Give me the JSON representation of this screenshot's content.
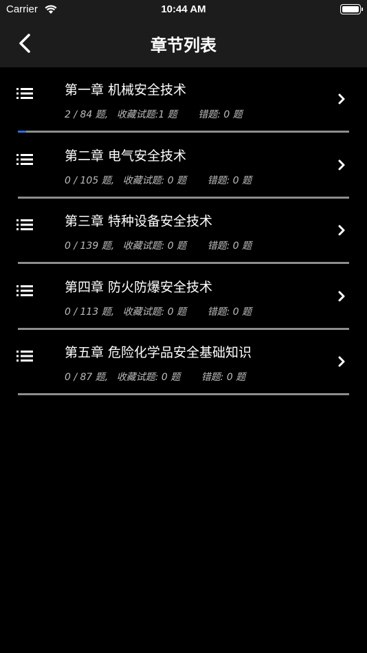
{
  "status_bar": {
    "carrier": "Carrier",
    "time": "10:44 AM"
  },
  "nav": {
    "title": "章节列表",
    "back_icon": "chevron-left-icon"
  },
  "chapters": [
    {
      "title": "第一章 机械安全技术",
      "progress": "2 / 84 题,",
      "favorites": "收藏试题:1 题",
      "errors": "错题: 0 题",
      "progress_fraction": 0.024
    },
    {
      "title": "第二章 电气安全技术",
      "progress": "0 / 105 题,",
      "favorites": "收藏试题: 0 题",
      "errors": "错题: 0 题",
      "progress_fraction": 0
    },
    {
      "title": "第三章 特种设备安全技术",
      "progress": "0 / 139 题,",
      "favorites": "收藏试题: 0 题",
      "errors": "错题: 0 题",
      "progress_fraction": 0
    },
    {
      "title": "第四章 防火防爆安全技术",
      "progress": "0 / 113 题,",
      "favorites": "收藏试题: 0 题",
      "errors": "错题: 0 题",
      "progress_fraction": 0
    },
    {
      "title": "第五章 危险化学品安全基础知识",
      "progress": "0 / 87 题,",
      "favorites": "收藏试题: 0 题",
      "errors": "错题: 0 题",
      "progress_fraction": 0
    }
  ],
  "colors": {
    "background": "#000000",
    "bar": "#1c1c1c",
    "progress": "#2f6fd6",
    "divider": "#8e8e8e"
  }
}
